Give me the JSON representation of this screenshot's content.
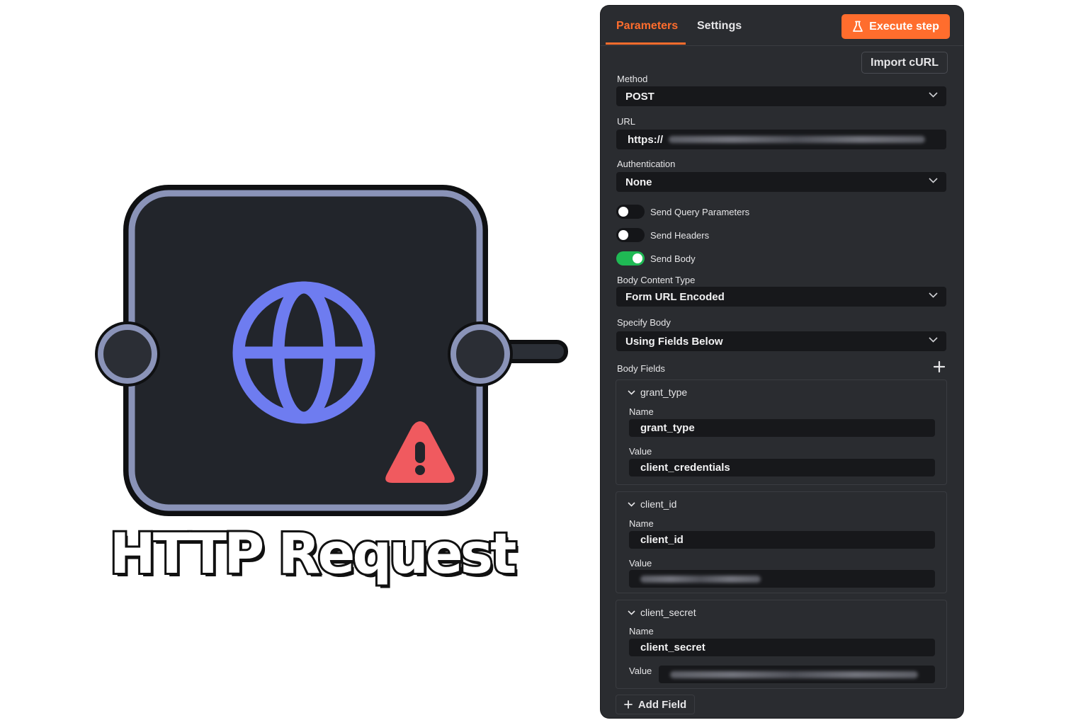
{
  "node": {
    "title": "HTTP Request",
    "icon": "globe-icon",
    "warning_icon": "warning-icon",
    "colors": {
      "body": "#22252b",
      "border": "#8a93b8",
      "globe": "#6e7cf0",
      "warning": "#f05a5f"
    }
  },
  "panel": {
    "tabs": {
      "parameters": "Parameters",
      "settings": "Settings"
    },
    "execute_label": "Execute step",
    "import_label": "Import cURL",
    "method": {
      "label": "Method",
      "value": "POST"
    },
    "url": {
      "label": "URL",
      "value": "https://"
    },
    "authentication": {
      "label": "Authentication",
      "value": "None"
    },
    "toggles": {
      "query": {
        "label": "Send Query Parameters",
        "on": false
      },
      "headers": {
        "label": "Send Headers",
        "on": false
      },
      "body": {
        "label": "Send Body",
        "on": true
      }
    },
    "body_content_type": {
      "label": "Body Content Type",
      "value": "Form URL Encoded"
    },
    "specify_body": {
      "label": "Specify Body",
      "value": "Using Fields Below"
    },
    "body_fields_label": "Body Fields",
    "fields": [
      {
        "header": "grant_type",
        "name_label": "Name",
        "name": "grant_type",
        "value_label": "Value",
        "value": "client_credentials"
      },
      {
        "header": "client_id",
        "name_label": "Name",
        "name": "client_id",
        "value_label": "Value",
        "value": ""
      },
      {
        "header": "client_secret",
        "name_label": "Name",
        "name": "client_secret",
        "value_label": "Value",
        "value": ""
      }
    ],
    "add_field_label": "Add Field",
    "accent_color": "#ff6d2d",
    "toggle_on_color": "#1fb954"
  }
}
